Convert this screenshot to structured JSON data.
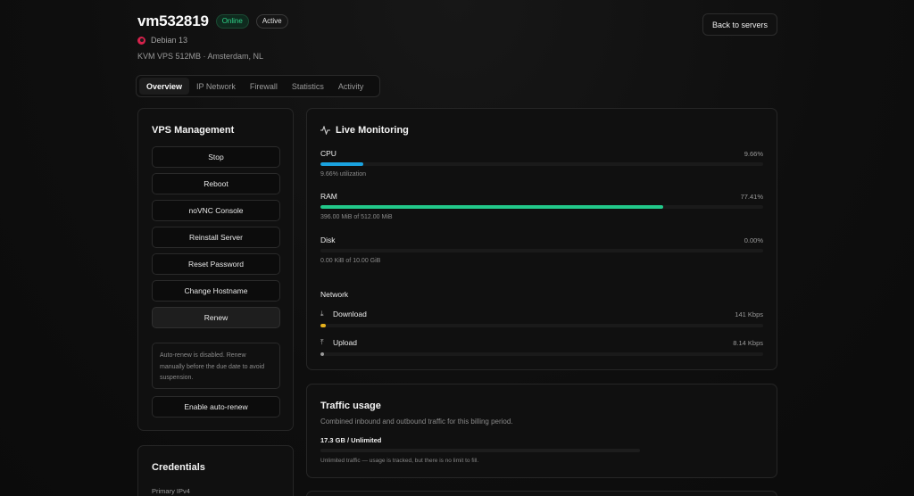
{
  "header": {
    "title": "vm532819",
    "status_online": "Online",
    "status_active": "Active",
    "os": "Debian 13",
    "plan": "KVM VPS 512MB · Amsterdam, NL",
    "back_label": "Back to servers"
  },
  "tabs": [
    {
      "label": "Overview",
      "active": true
    },
    {
      "label": "IP Network",
      "active": false
    },
    {
      "label": "Firewall",
      "active": false
    },
    {
      "label": "Statistics",
      "active": false
    },
    {
      "label": "Activity",
      "active": false
    }
  ],
  "management": {
    "title": "VPS Management",
    "buttons": [
      "Stop",
      "Reboot",
      "noVNC Console",
      "Reinstall Server",
      "Reset Password",
      "Change Hostname",
      "Renew"
    ],
    "note": "Auto-renew is disabled. Renew manually before the due date to avoid suspension.",
    "auto_renew_label": "Enable auto-renew"
  },
  "credentials": {
    "title": "Credentials",
    "primary_ipv4_label": "Primary IPv4"
  },
  "monitoring": {
    "title": "Live Monitoring",
    "cpu": {
      "label": "CPU",
      "value": "9.66%",
      "detail": "9.66% utilization",
      "fraction": 0.0966,
      "color": "#1aa3e0"
    },
    "ram": {
      "label": "RAM",
      "value": "77.41%",
      "detail": "396.00 MiB of 512.00 MiB",
      "fraction": 0.7741,
      "color": "#22c98a"
    },
    "disk": {
      "label": "Disk",
      "value": "0.00%",
      "detail": "0.00 KiB of 10.00 GiB",
      "fraction": 0.0,
      "color": "#22c98a"
    },
    "network_label": "Network",
    "download": {
      "label": "Download",
      "value": "141 Kbps",
      "fraction": 0.012,
      "color": "#e8b21c"
    },
    "upload": {
      "label": "Upload",
      "value": "8.14 Kbps",
      "fraction": 0.002,
      "color": "#9a9a9a"
    }
  },
  "traffic": {
    "title": "Traffic usage",
    "description": "Combined inbound and outbound traffic for this billing period.",
    "amount": "17.3 GB / Unlimited",
    "footnote": "Unlimited traffic — usage is tracked, but there is no limit to fill."
  }
}
